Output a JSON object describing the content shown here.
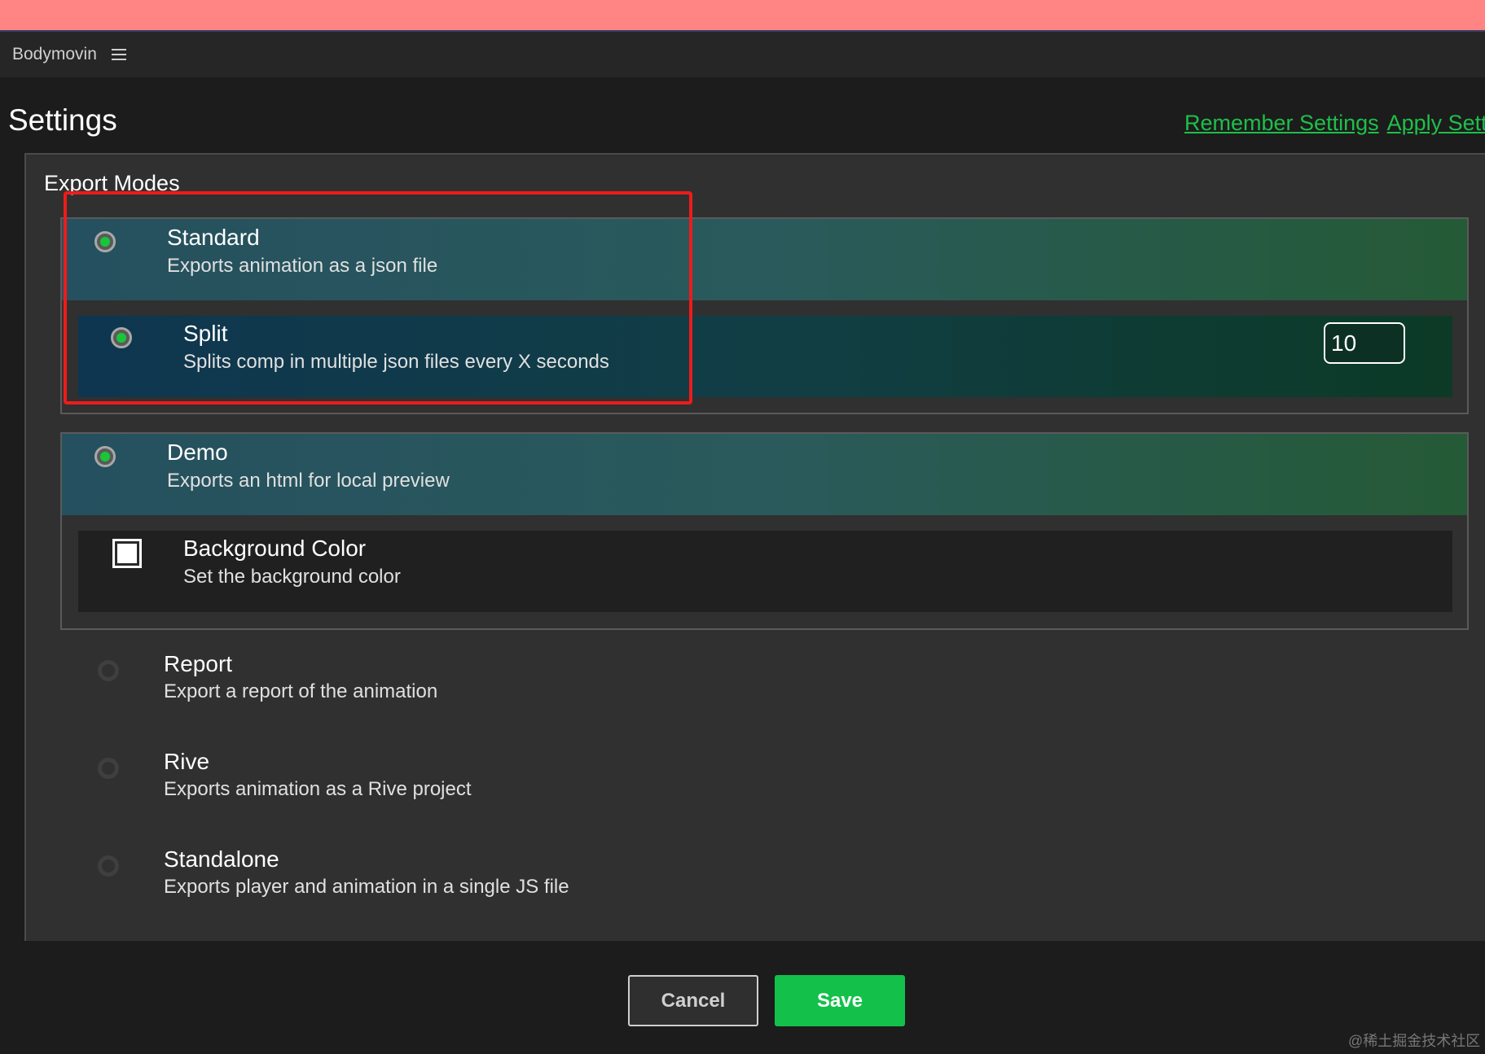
{
  "app": {
    "title": "Bodymovin",
    "menu_icon": "hamburger-menu-icon"
  },
  "header": {
    "title": "Settings",
    "remember_settings": "Remember Settings",
    "apply_settings": "Apply Setti"
  },
  "export_modes": {
    "label": "Export Modes",
    "standard": {
      "title": "Standard",
      "description": "Exports animation as a json file",
      "selected": true,
      "split": {
        "title": "Split",
        "description": "Splits comp in multiple json files every X seconds",
        "enabled": true,
        "seconds_value": "10"
      }
    },
    "demo": {
      "title": "Demo",
      "description": "Exports an html for local preview",
      "selected": true,
      "background_color": {
        "title": "Background Color",
        "description": "Set the background color",
        "color": "#ffffff"
      }
    },
    "report": {
      "title": "Report",
      "description": "Export a report of the animation",
      "selected": false
    },
    "rive": {
      "title": "Rive",
      "description": "Exports animation as a Rive project",
      "selected": false
    },
    "standalone": {
      "title": "Standalone",
      "description": "Exports player and animation in a single JS file",
      "selected": false
    }
  },
  "footer": {
    "cancel_label": "Cancel",
    "save_label": "Save"
  },
  "watermark": "@稀土掘金技术社区",
  "colors": {
    "accent_green": "#13c14a",
    "link_green": "#1fbf4a",
    "highlight_red": "#ee1b1b",
    "top_strip": "#ff8585"
  }
}
